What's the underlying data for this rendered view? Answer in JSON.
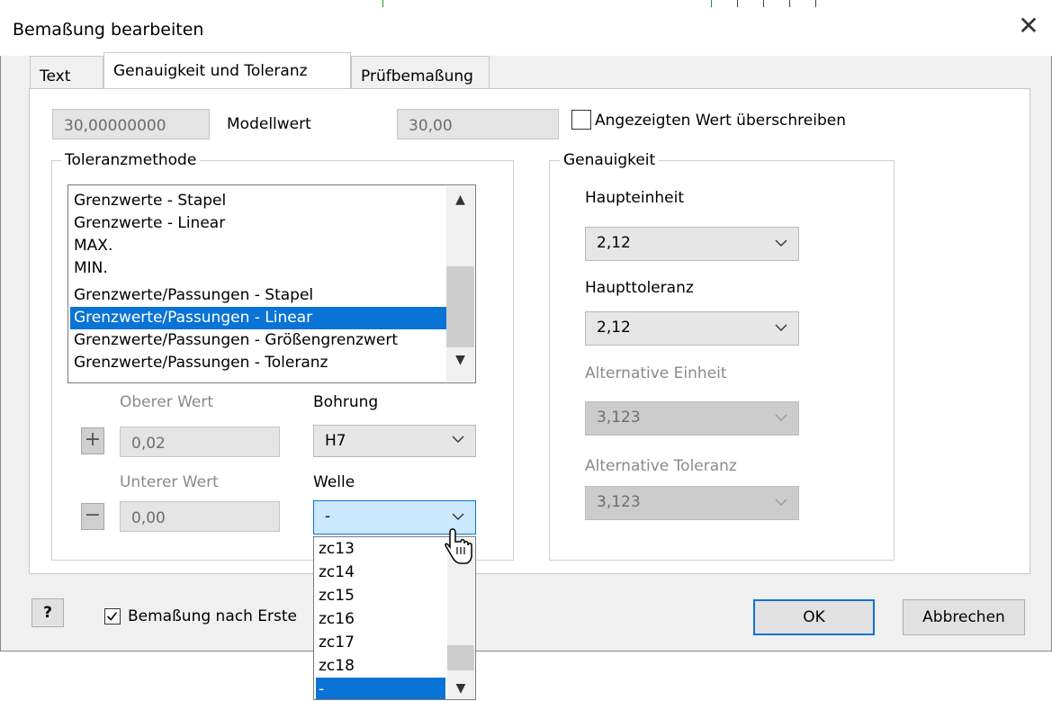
{
  "window": {
    "title": "Bemaßung bearbeiten",
    "close_glyph": "✕"
  },
  "tabs": [
    {
      "label": "Text",
      "active": false
    },
    {
      "label": "Genauigkeit und Toleranz",
      "active": true
    },
    {
      "label": "Prüfbemaßung",
      "active": false
    }
  ],
  "model_value": {
    "left_value": "30,00000000",
    "label": "Modellwert",
    "display_value": "30,00",
    "override_label": "Angezeigten Wert überschreiben",
    "override_checked": false
  },
  "tolerance_method": {
    "legend": "Toleranzmethode",
    "items": [
      "Grenzwerte - Stapel",
      "Grenzwerte - Linear",
      "MAX.",
      "MIN.",
      "Grenzwerte/Passungen - Stapel",
      "Grenzwerte/Passungen - Linear",
      "Grenzwerte/Passungen - Größengrenzwert",
      "Grenzwerte/Passungen - Toleranz"
    ],
    "selected_index": 5
  },
  "limits": {
    "upper_label": "Oberer Wert",
    "upper_value": "0,02",
    "plus_glyph": "+",
    "lower_label": "Unterer Wert",
    "lower_value": "0,00",
    "minus_glyph": "−",
    "hole_label": "Bohrung",
    "hole_value": "H7",
    "shaft_label": "Welle",
    "shaft_value": "-"
  },
  "precision": {
    "legend": "Genauigkeit",
    "primary_unit_label": "Haupteinheit",
    "primary_unit_value": "2,12",
    "primary_tol_label": "Haupttoleranz",
    "primary_tol_value": "2,12",
    "alt_unit_label": "Alternative Einheit",
    "alt_unit_value": "3,123",
    "alt_tol_label": "Alternative Toleranz",
    "alt_tol_value": "3,123"
  },
  "shaft_dropdown": {
    "items": [
      "zc13",
      "zc14",
      "zc15",
      "zc16",
      "zc17",
      "zc18",
      "-"
    ],
    "selected_index": 6
  },
  "footer": {
    "help_glyph": "?",
    "checkbox_label": "Bemaßung nach Erste",
    "checkbox_checked": true,
    "ok_label": "OK",
    "cancel_label": "Abbrechen"
  }
}
